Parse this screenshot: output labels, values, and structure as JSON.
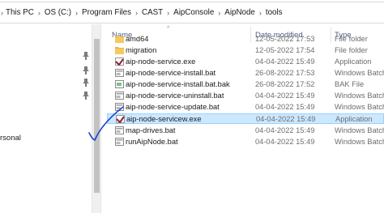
{
  "breadcrumb": [
    "This PC",
    "OS (C:)",
    "Program Files",
    "CAST",
    "AipConsole",
    "AipNode",
    "tools"
  ],
  "nav": {
    "partial_label": "rsonal"
  },
  "columns": {
    "name": "Name",
    "date": "Date modified",
    "type": "Type"
  },
  "files": [
    {
      "name": "amd64",
      "date": "12-05-2022 17:53",
      "type": "File folder",
      "icon": "folder-icon"
    },
    {
      "name": "migration",
      "date": "12-05-2022 17:54",
      "type": "File folder",
      "icon": "folder-icon"
    },
    {
      "name": "aip-node-service.exe",
      "date": "04-04-2022 15:49",
      "type": "Application",
      "icon": "application-icon"
    },
    {
      "name": "aip-node-service-install.bat",
      "date": "26-08-2022 17:53",
      "type": "Windows Batch F",
      "icon": "batch-file-icon"
    },
    {
      "name": "aip-node-service-install.bat.bak",
      "date": "26-08-2022 17:52",
      "type": "BAK File",
      "icon": "bak-file-icon"
    },
    {
      "name": "aip-node-service-uninstall.bat",
      "date": "04-04-2022 15:49",
      "type": "Windows Batch F",
      "icon": "batch-file-icon"
    },
    {
      "name": "aip-node-service-update.bat",
      "date": "04-04-2022 15:49",
      "type": "Windows Batch F",
      "icon": "batch-file-icon"
    },
    {
      "name": "aip-node-servicew.exe",
      "date": "04-04-2022 15:49",
      "type": "Application",
      "icon": "application-icon",
      "selected": true
    },
    {
      "name": "map-drives.bat",
      "date": "04-04-2022 15:49",
      "type": "Windows Batch F",
      "icon": "batch-file-icon"
    },
    {
      "name": "runAipNode.bat",
      "date": "04-04-2022 15:49",
      "type": "Windows Batch F",
      "icon": "batch-file-icon"
    }
  ],
  "colors": {
    "folder": "#e8b64c",
    "selection": "#cce8ff",
    "selection_border": "#99d1ff",
    "header_text": "#4c607a",
    "annotation": "#1a3fd1"
  }
}
